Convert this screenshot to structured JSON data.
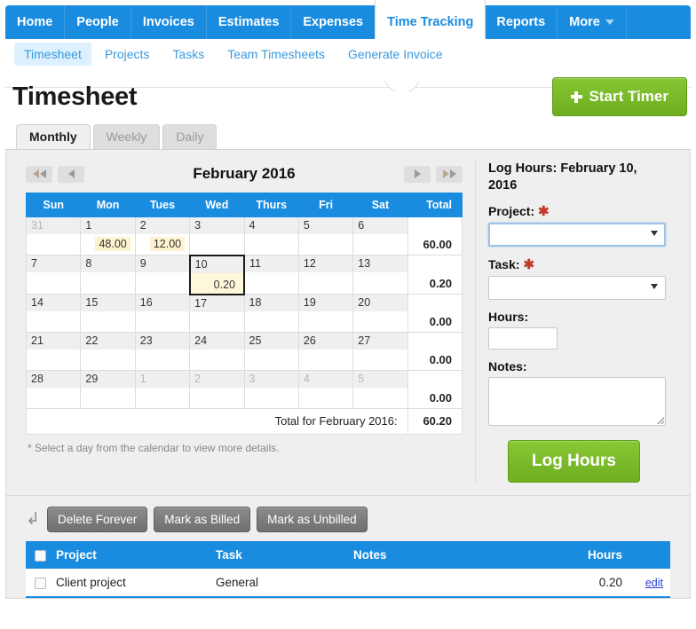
{
  "topnav": {
    "items": [
      {
        "label": "Home",
        "active": false
      },
      {
        "label": "People",
        "active": false
      },
      {
        "label": "Invoices",
        "active": false
      },
      {
        "label": "Estimates",
        "active": false
      },
      {
        "label": "Expenses",
        "active": false
      },
      {
        "label": "Time Tracking",
        "active": true
      },
      {
        "label": "Reports",
        "active": false
      },
      {
        "label": "More",
        "active": false,
        "caret": true
      }
    ],
    "accent_color": "#1a8ce0"
  },
  "subnav": {
    "items": [
      {
        "label": "Timesheet",
        "active": true
      },
      {
        "label": "Projects",
        "active": false
      },
      {
        "label": "Tasks",
        "active": false
      },
      {
        "label": "Team Timesheets",
        "active": false
      },
      {
        "label": "Generate Invoice",
        "active": false
      }
    ]
  },
  "header": {
    "title": "Timesheet",
    "start_timer_label": "Start Timer",
    "start_timer_color": "#79bd28"
  },
  "mode_tabs": [
    {
      "label": "Monthly",
      "active": true
    },
    {
      "label": "Weekly",
      "active": false
    },
    {
      "label": "Daily",
      "active": false
    }
  ],
  "calendar": {
    "nav": {
      "prev_year_label": "◄◄",
      "prev_month_label": "◄",
      "next_month_label": "►",
      "next_year_label": "►►"
    },
    "month_title": "February 2016",
    "headers": [
      "Sun",
      "Mon",
      "Tues",
      "Wed",
      "Thurs",
      "Fri",
      "Sat",
      "Total"
    ],
    "weeks": [
      {
        "days": [
          {
            "num": "31",
            "hours": "",
            "other_month": true,
            "selected": false
          },
          {
            "num": "1",
            "hours": "48.00",
            "other_month": false,
            "selected": false
          },
          {
            "num": "2",
            "hours": "12.00",
            "other_month": false,
            "selected": false
          },
          {
            "num": "3",
            "hours": "",
            "other_month": false,
            "selected": false
          },
          {
            "num": "4",
            "hours": "",
            "other_month": false,
            "selected": false
          },
          {
            "num": "5",
            "hours": "",
            "other_month": false,
            "selected": false
          },
          {
            "num": "6",
            "hours": "",
            "other_month": false,
            "selected": false
          }
        ],
        "total": "60.00"
      },
      {
        "days": [
          {
            "num": "7",
            "hours": "",
            "other_month": false,
            "selected": false
          },
          {
            "num": "8",
            "hours": "",
            "other_month": false,
            "selected": false
          },
          {
            "num": "9",
            "hours": "",
            "other_month": false,
            "selected": false
          },
          {
            "num": "10",
            "hours": "0.20",
            "other_month": false,
            "selected": true
          },
          {
            "num": "11",
            "hours": "",
            "other_month": false,
            "selected": false
          },
          {
            "num": "12",
            "hours": "",
            "other_month": false,
            "selected": false
          },
          {
            "num": "13",
            "hours": "",
            "other_month": false,
            "selected": false
          }
        ],
        "total": "0.20"
      },
      {
        "days": [
          {
            "num": "14",
            "hours": "",
            "other_month": false,
            "selected": false
          },
          {
            "num": "15",
            "hours": "",
            "other_month": false,
            "selected": false
          },
          {
            "num": "16",
            "hours": "",
            "other_month": false,
            "selected": false
          },
          {
            "num": "17",
            "hours": "",
            "other_month": false,
            "selected": false
          },
          {
            "num": "18",
            "hours": "",
            "other_month": false,
            "selected": false
          },
          {
            "num": "19",
            "hours": "",
            "other_month": false,
            "selected": false
          },
          {
            "num": "20",
            "hours": "",
            "other_month": false,
            "selected": false
          }
        ],
        "total": "0.00"
      },
      {
        "days": [
          {
            "num": "21",
            "hours": "",
            "other_month": false,
            "selected": false
          },
          {
            "num": "22",
            "hours": "",
            "other_month": false,
            "selected": false
          },
          {
            "num": "23",
            "hours": "",
            "other_month": false,
            "selected": false
          },
          {
            "num": "24",
            "hours": "",
            "other_month": false,
            "selected": false
          },
          {
            "num": "25",
            "hours": "",
            "other_month": false,
            "selected": false
          },
          {
            "num": "26",
            "hours": "",
            "other_month": false,
            "selected": false
          },
          {
            "num": "27",
            "hours": "",
            "other_month": false,
            "selected": false
          }
        ],
        "total": "0.00"
      },
      {
        "days": [
          {
            "num": "28",
            "hours": "",
            "other_month": false,
            "selected": false
          },
          {
            "num": "29",
            "hours": "",
            "other_month": false,
            "selected": false
          },
          {
            "num": "1",
            "hours": "",
            "other_month": true,
            "selected": false
          },
          {
            "num": "2",
            "hours": "",
            "other_month": true,
            "selected": false
          },
          {
            "num": "3",
            "hours": "",
            "other_month": true,
            "selected": false
          },
          {
            "num": "4",
            "hours": "",
            "other_month": true,
            "selected": false
          },
          {
            "num": "5",
            "hours": "",
            "other_month": true,
            "selected": false
          }
        ],
        "total": "0.00"
      }
    ],
    "grand_total_label": "Total for February 2016:",
    "grand_total_value": "60.20",
    "note": "* Select a day from the calendar to view more details."
  },
  "log_form": {
    "title": "Log Hours: February 10, 2016",
    "project_label": "Project:",
    "project_value": "",
    "task_label": "Task:",
    "task_value": "",
    "hours_label": "Hours:",
    "hours_value": "",
    "notes_label": "Notes:",
    "notes_value": "",
    "required_marker": "✱",
    "submit_label": "Log Hours"
  },
  "entries": {
    "toolbar": [
      {
        "label": "Delete Forever"
      },
      {
        "label": "Mark as Billed"
      },
      {
        "label": "Mark as Unbilled"
      }
    ],
    "columns": [
      "Project",
      "Task",
      "Notes",
      "Hours"
    ],
    "rows": [
      {
        "project": "Client project",
        "task": "General",
        "notes": "",
        "hours": "0.20",
        "edit_label": "edit"
      }
    ]
  }
}
